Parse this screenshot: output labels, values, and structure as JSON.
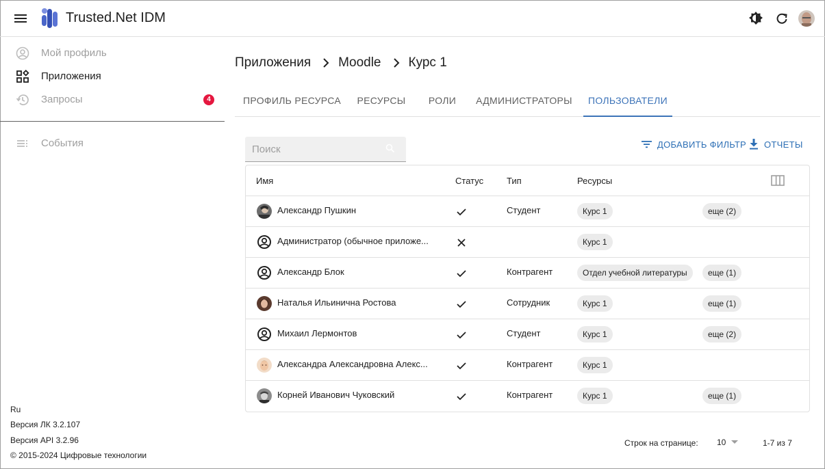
{
  "app": {
    "title": "Trusted.Net IDM"
  },
  "colors": {
    "accent": "#3c73b8",
    "badge": "#e5173f",
    "logo": "#4a66c9"
  },
  "sidebar": {
    "items": [
      {
        "label": "Мой профиль",
        "icon": "account-circle-icon"
      },
      {
        "label": "Приложения",
        "icon": "apps-icon"
      },
      {
        "label": "Запросы",
        "icon": "history-icon",
        "badge": "4"
      },
      {
        "label": "События",
        "icon": "list-icon"
      }
    ],
    "footer": {
      "lang": "Ru",
      "version_lk": "Версия ЛК 3.2.107",
      "version_api": "Версия API 3.2.96",
      "copyright": "© 2015-2024 Цифровые технологии"
    }
  },
  "breadcrumb": [
    "Приложения",
    "Moodle",
    "Курс 1"
  ],
  "tabs": [
    {
      "label": "ПРОФИЛЬ РЕСУРСА"
    },
    {
      "label": "РЕСУРСЫ"
    },
    {
      "label": "РОЛИ"
    },
    {
      "label": "АДМИНИСТРАТОРЫ"
    },
    {
      "label": "ПОЛЬЗОВАТЕЛИ",
      "active": true
    }
  ],
  "search": {
    "placeholder": "Поиск",
    "value": ""
  },
  "actions": {
    "add_filter": "ДОБАВИТЬ ФИЛЬТР",
    "reports": "ОТЧЕТЫ"
  },
  "table": {
    "headers": {
      "name": "Имя",
      "status": "Статус",
      "type": "Тип",
      "resources": "Ресурсы"
    },
    "rows": [
      {
        "name": "Александр Пушкин",
        "avatar": "photo",
        "status": "active",
        "type": "Студент",
        "resource": "Курс 1",
        "more": "еще (2)"
      },
      {
        "name": "Администратор (обычное приложе...",
        "avatar": "default",
        "status": "blocked",
        "type": "",
        "resource": "Курс 1",
        "more": ""
      },
      {
        "name": "Александр Блок",
        "avatar": "default",
        "status": "active",
        "type": "Контрагент",
        "resource": "Отдел учебной литературы",
        "more": "еще (1)"
      },
      {
        "name": "Наталья Ильинична Ростова",
        "avatar": "photo",
        "status": "active",
        "type": "Сотрудник",
        "resource": "Курс 1",
        "more": "еще (1)"
      },
      {
        "name": "Михаил Лермонтов",
        "avatar": "default",
        "status": "active",
        "type": "Студент",
        "resource": "Курс 1",
        "more": "еще (2)"
      },
      {
        "name": "Александра Александровна Алекс...",
        "avatar": "photo",
        "status": "active",
        "type": "Контрагент",
        "resource": "Курс 1",
        "more": ""
      },
      {
        "name": "Корней Иванович Чуковский",
        "avatar": "photo",
        "status": "active",
        "type": "Контрагент",
        "resource": "Курс 1",
        "more": "еще (1)"
      }
    ]
  },
  "pagination": {
    "rows_label": "Строк на странице:",
    "rows_value": "10",
    "range": "1-7 из 7"
  }
}
